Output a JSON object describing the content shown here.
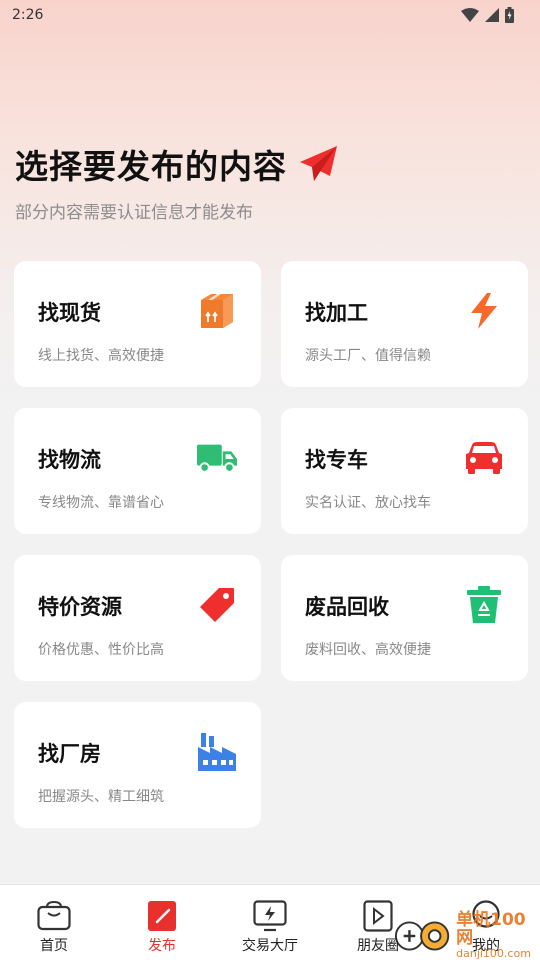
{
  "status": {
    "time": "2:26"
  },
  "header": {
    "title": "选择要发布的内容",
    "subtitle": "部分内容需要认证信息才能发布"
  },
  "cards": [
    {
      "title": "找现货",
      "desc": "线上找货、高效便捷",
      "icon": "box-icon",
      "color": "#f5883a"
    },
    {
      "title": "找加工",
      "desc": "源头工厂、值得信赖",
      "icon": "lightning-icon",
      "color": "#f56a2a"
    },
    {
      "title": "找物流",
      "desc": "专线物流、靠谱省心",
      "icon": "truck-icon",
      "color": "#2fbd74"
    },
    {
      "title": "找专车",
      "desc": "实名认证、放心找车",
      "icon": "car-icon",
      "color": "#ef2e2e"
    },
    {
      "title": "特价资源",
      "desc": "价格优惠、性价比高",
      "icon": "price-tag-icon",
      "color": "#ef2e2e"
    },
    {
      "title": "废品回收",
      "desc": "废料回收、高效便捷",
      "icon": "recycle-bin-icon",
      "color": "#1fbf75"
    },
    {
      "title": "找厂房",
      "desc": "把握源头、精工细筑",
      "icon": "factory-icon",
      "color": "#3c82e6"
    }
  ],
  "tabbar": {
    "items": [
      {
        "label": "首页",
        "icon": "home-bag-icon",
        "active": false
      },
      {
        "label": "发布",
        "icon": "publish-icon",
        "active": true
      },
      {
        "label": "交易大厅",
        "icon": "trade-hall-icon",
        "active": false
      },
      {
        "label": "朋友圈",
        "icon": "moments-icon",
        "active": false
      },
      {
        "label": "我的",
        "icon": "profile-icon",
        "active": false
      }
    ]
  },
  "watermark": {
    "cn": "单机100网",
    "en": "danji100.com"
  },
  "colors": {
    "accent": "#e8302c"
  }
}
